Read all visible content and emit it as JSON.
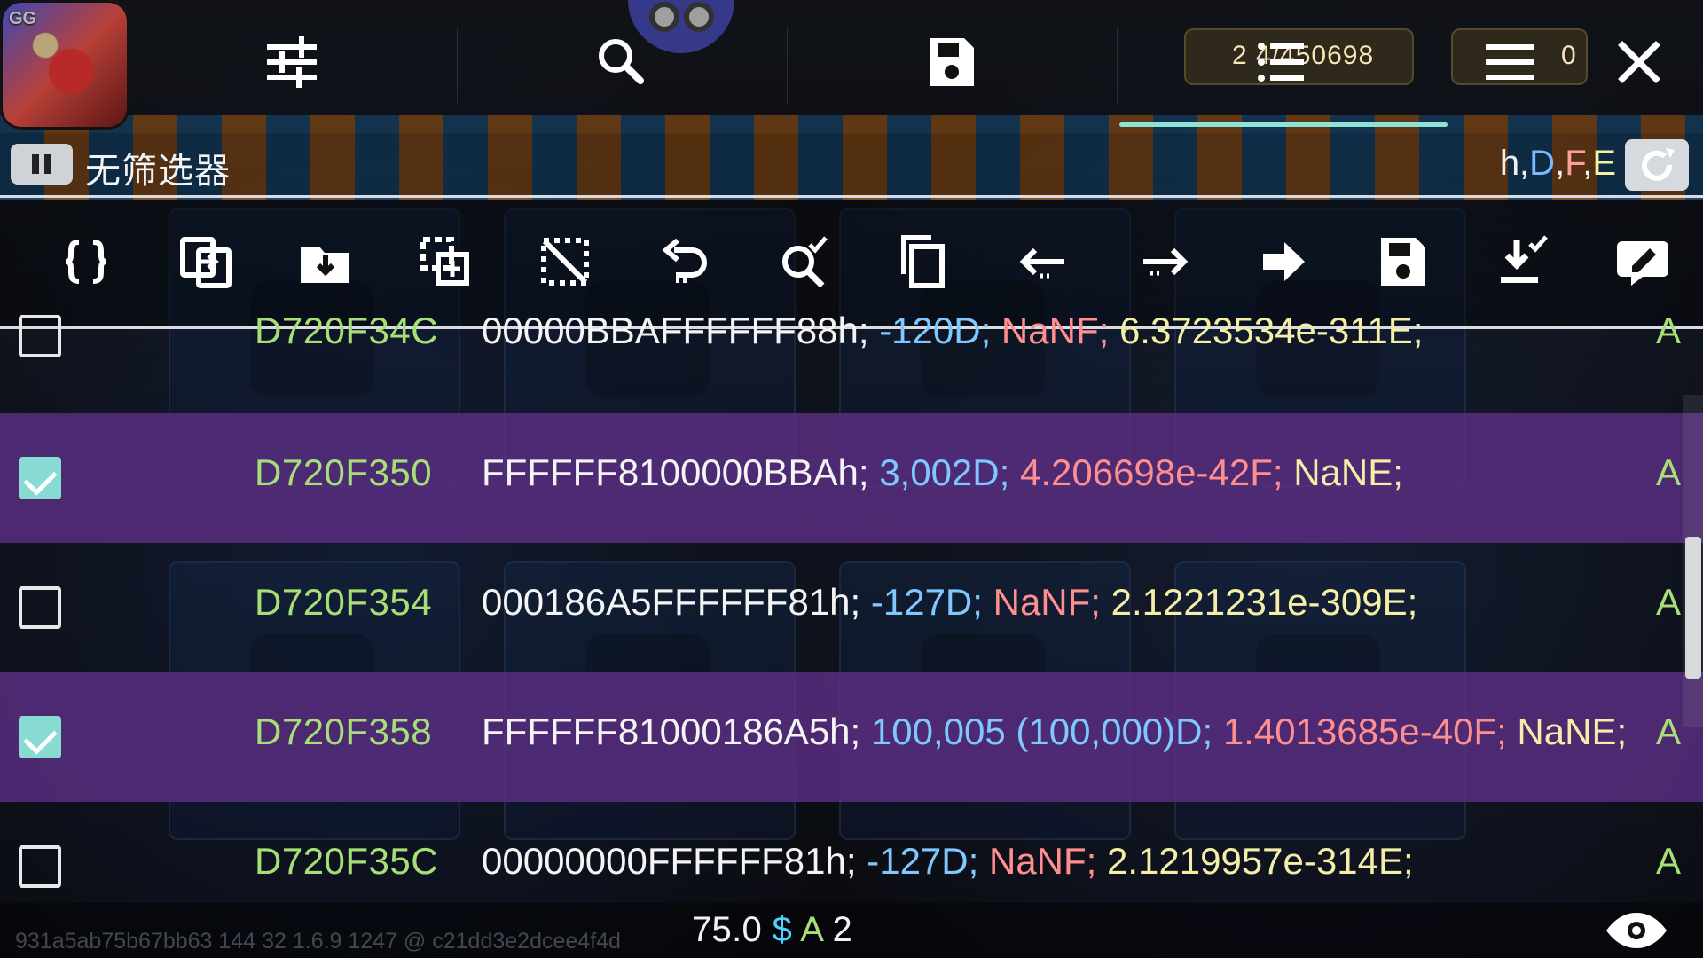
{
  "app": {
    "icon_label": "GG"
  },
  "top_toolbar": {
    "buttons": [
      {
        "icon": "sliders-icon"
      },
      {
        "icon": "search-icon"
      },
      {
        "icon": "save-icon"
      },
      {
        "icon": "list-icon"
      },
      {
        "icon": "menu-icon"
      },
      {
        "icon": "close-icon"
      }
    ],
    "resource_count": "2 4/450698",
    "coin_count": "0"
  },
  "filter_bar": {
    "label": "无筛选器",
    "types_prefix": "h,",
    "types_d": "D",
    "types_comma_1": ",",
    "types_f": "F",
    "types_comma_2": ",",
    "types_e": "E"
  },
  "tool_row": {
    "icons": [
      "braces-icon",
      "copy-icon",
      "folder-download-icon",
      "target-copy-icon",
      "deselect-icon",
      "undo-icon",
      "search-check-icon",
      "duplicate-icon",
      "arrow-left-icon",
      "arrow-right-icon",
      "right-arrow-fill-icon",
      "save-icon",
      "download-check-icon",
      "edit-comment-icon"
    ]
  },
  "results": [
    {
      "address": "D720F34C",
      "hex": "00000BBAFFFFFF88h;",
      "dword": "-120D;",
      "float": "NaNF;",
      "double": "6.3723534e-311E;",
      "type": "A",
      "checked": false
    },
    {
      "address": "D720F350",
      "hex": "FFFFFF8100000BBAh;",
      "dword": "3,002D;",
      "float": "4.206698e-42F;",
      "double": "NaNE;",
      "type": "A",
      "checked": true
    },
    {
      "address": "D720F354",
      "hex": "000186A5FFFFFF81h;",
      "dword": "-127D;",
      "float": "NaNF;",
      "double": "2.1221231e-309E;",
      "type": "A",
      "checked": false
    },
    {
      "address": "D720F358",
      "hex": "FFFFFF81000186A5h;",
      "dword": "100,005 (100,000)D;",
      "float": "1.4013685e-40F;",
      "double": "NaNE;",
      "type": "A",
      "checked": true
    },
    {
      "address": "D720F35C",
      "hex": "00000000FFFFFF81h;",
      "dword": "-127D;",
      "float": "NaNF;",
      "double": "2.1219957e-314E;",
      "type": "A",
      "checked": false
    }
  ],
  "footer": {
    "build": "931a5ab75b67bb63 144 32 1.6.9 1247 @ c21dd3e2dcee4f4d",
    "value": "75.0",
    "currency": "$",
    "type": "A",
    "count": "2"
  }
}
